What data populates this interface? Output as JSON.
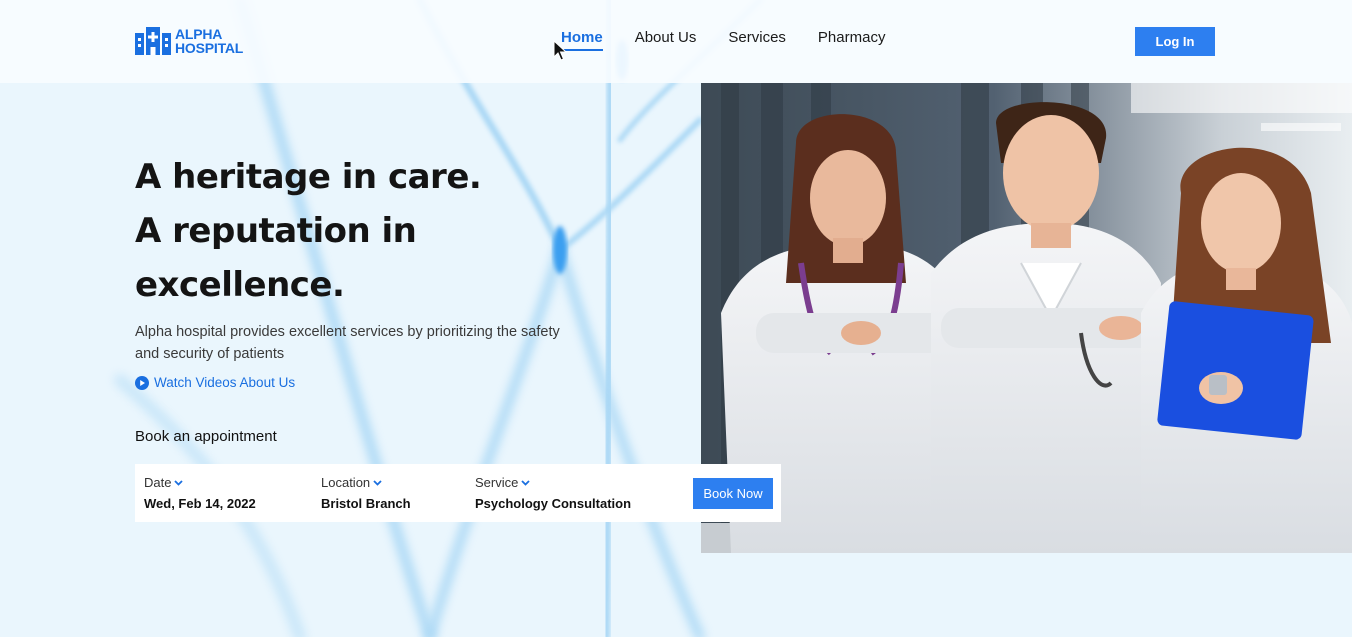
{
  "brand": {
    "line1": "ALPHA",
    "line2": "HOSPITAL",
    "color": "#1a6fe0"
  },
  "nav": {
    "items": [
      {
        "label": "Home",
        "active": true
      },
      {
        "label": "About Us",
        "active": false
      },
      {
        "label": "Services",
        "active": false
      },
      {
        "label": "Pharmacy",
        "active": false
      }
    ]
  },
  "header": {
    "login_label": "Log In"
  },
  "hero": {
    "title_lines": [
      "A heritage in care.",
      "A reputation in",
      "excellence."
    ],
    "description": "Alpha hospital provides excellent services by prioritizing the safety and security of patients",
    "watch_label": "Watch Videos About Us"
  },
  "booking": {
    "heading": "Book an appointment",
    "date": {
      "label": "Date",
      "value": "Wed, Feb 14, 2022"
    },
    "location": {
      "label": "Location",
      "value": "Bristol Branch"
    },
    "service": {
      "label": "Service",
      "value": "Psychology Consultation"
    },
    "submit_label": "Book Now"
  },
  "theme": {
    "accent": "#2d7ff0",
    "background": "#eaf6fd"
  }
}
